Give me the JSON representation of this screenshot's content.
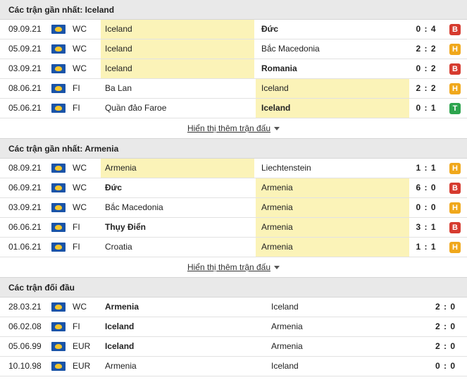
{
  "sections": [
    {
      "title": "Các trận gần nhất: Iceland",
      "more_label": "Hiển thị thêm trận đấu",
      "rows": [
        {
          "date": "09.09.21",
          "comp": "WC",
          "home": "Iceland",
          "away": "Đức",
          "score": "0 : 4",
          "result": "B",
          "hl": "home",
          "bold": "away"
        },
        {
          "date": "05.09.21",
          "comp": "WC",
          "home": "Iceland",
          "away": "Bắc Macedonia",
          "score": "2 : 2",
          "result": "H",
          "hl": "home",
          "bold": ""
        },
        {
          "date": "03.09.21",
          "comp": "WC",
          "home": "Iceland",
          "away": "Romania",
          "score": "0 : 2",
          "result": "B",
          "hl": "home",
          "bold": "away"
        },
        {
          "date": "08.06.21",
          "comp": "FI",
          "home": "Ba Lan",
          "away": "Iceland",
          "score": "2 : 2",
          "result": "H",
          "hl": "away",
          "bold": ""
        },
        {
          "date": "05.06.21",
          "comp": "FI",
          "home": "Quần đảo Faroe",
          "away": "Iceland",
          "score": "0 : 1",
          "result": "T",
          "hl": "away",
          "bold": "away"
        }
      ]
    },
    {
      "title": "Các trận gần nhất: Armenia",
      "more_label": "Hiển thị thêm trận đấu",
      "rows": [
        {
          "date": "08.09.21",
          "comp": "WC",
          "home": "Armenia",
          "away": "Liechtenstein",
          "score": "1 : 1",
          "result": "H",
          "hl": "home",
          "bold": ""
        },
        {
          "date": "06.09.21",
          "comp": "WC",
          "home": "Đức",
          "away": "Armenia",
          "score": "6 : 0",
          "result": "B",
          "hl": "away",
          "bold": "home"
        },
        {
          "date": "03.09.21",
          "comp": "WC",
          "home": "Bắc Macedonia",
          "away": "Armenia",
          "score": "0 : 0",
          "result": "H",
          "hl": "away",
          "bold": ""
        },
        {
          "date": "06.06.21",
          "comp": "FI",
          "home": "Thụy Điển",
          "away": "Armenia",
          "score": "3 : 1",
          "result": "B",
          "hl": "away",
          "bold": "home"
        },
        {
          "date": "01.06.21",
          "comp": "FI",
          "home": "Croatia",
          "away": "Armenia",
          "score": "1 : 1",
          "result": "H",
          "hl": "away",
          "bold": ""
        }
      ]
    }
  ],
  "h2h": {
    "title": "Các trận đối đầu",
    "rows": [
      {
        "date": "28.03.21",
        "comp": "WC",
        "home": "Armenia",
        "away": "Iceland",
        "score": "2 : 0",
        "bold": "home"
      },
      {
        "date": "06.02.08",
        "comp": "FI",
        "home": "Iceland",
        "away": "Armenia",
        "score": "2 : 0",
        "bold": "home"
      },
      {
        "date": "05.06.99",
        "comp": "EUR",
        "home": "Iceland",
        "away": "Armenia",
        "score": "2 : 0",
        "bold": "home"
      },
      {
        "date": "10.10.98",
        "comp": "EUR",
        "home": "Armenia",
        "away": "Iceland",
        "score": "0 : 0",
        "bold": ""
      }
    ]
  },
  "colors": {
    "loss": "#d63b2f",
    "draw": "#f0a81c",
    "win": "#2da44e",
    "highlight": "#fbf3b8"
  },
  "icons": {
    "competition": "flag-icon",
    "expand": "caret-down-icon"
  }
}
